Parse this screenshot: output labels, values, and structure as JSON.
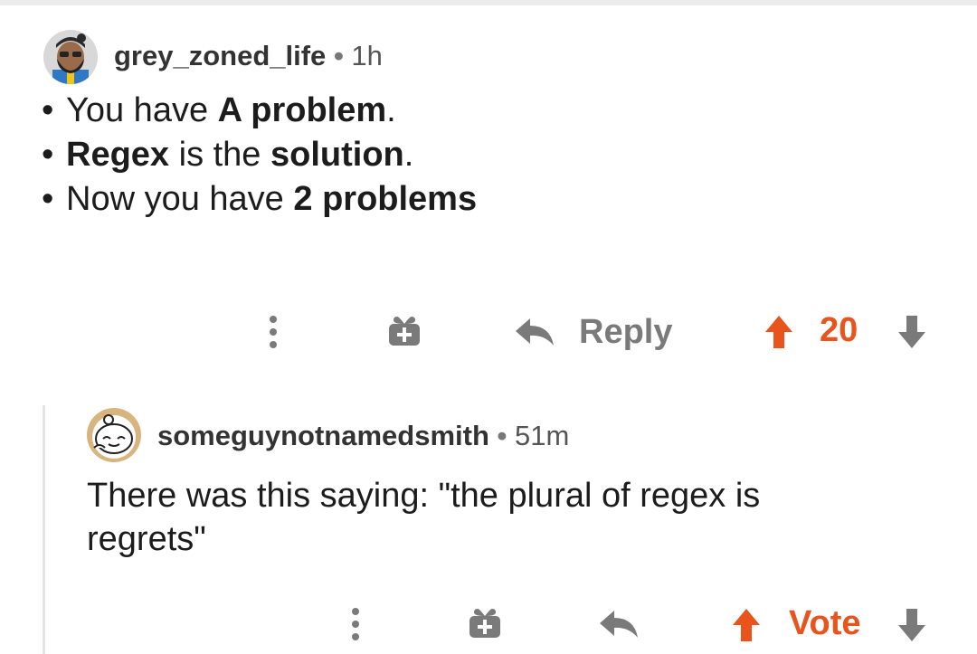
{
  "comment1": {
    "username": "grey_zoned_life",
    "separator": "•",
    "time": "1h",
    "lines": [
      {
        "a": "You have ",
        "b": "A problem",
        "c": "."
      },
      {
        "a": "",
        "b": "Regex",
        "c": " is the "
      },
      {
        "a": "Now you have ",
        "b": "2 problems",
        "c": ""
      }
    ],
    "line2_b2": "solution",
    "line2_tail": ".",
    "actions": {
      "more_icon": "more-vertical-icon",
      "award_icon": "gift-icon",
      "reply_icon": "reply-arrow-icon",
      "reply_label": "Reply",
      "upvote_icon": "arrow-up-icon",
      "score": "20",
      "downvote_icon": "arrow-down-icon"
    }
  },
  "comment2": {
    "username": "someguynotnamedsmith",
    "separator": "•",
    "time": "51m",
    "text_line1": "There was this saying: \"the plural of regex is",
    "text_line2": "regrets\"",
    "actions": {
      "more_icon": "more-vertical-icon",
      "award_icon": "gift-icon",
      "reply_icon": "reply-arrow-icon",
      "upvote_icon": "arrow-up-icon",
      "vote_label": "Vote",
      "downvote_icon": "arrow-down-icon"
    }
  },
  "colors": {
    "accent": "#e8541c",
    "icon_grey": "#7a7a7a",
    "thread_line": "#e4e4e4"
  }
}
